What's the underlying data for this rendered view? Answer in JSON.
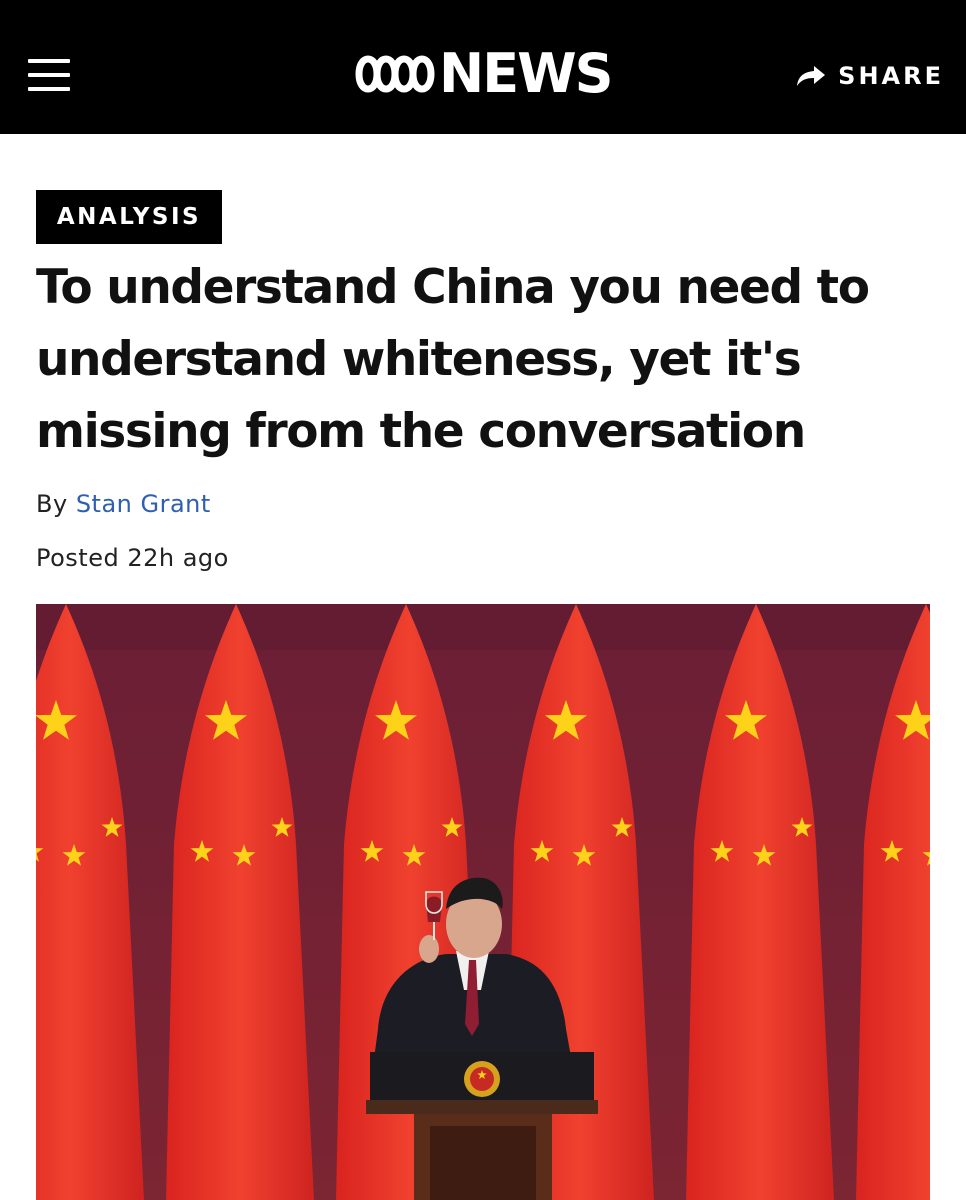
{
  "header": {
    "menu_icon": "hamburger-menu-icon",
    "logo_icon": "abc-lissajous-logo-icon",
    "logo_text": "NEWS",
    "share_icon": "share-arrow-icon",
    "share_label": "SHARE",
    "background_color": "#000000"
  },
  "article": {
    "category": "ANALYSIS",
    "headline": "To understand China you need to understand whiteness, yet it's missing from the conversation",
    "byline_prefix": "By",
    "author": "Stan Grant",
    "posted": "Posted 22h ago",
    "author_link_color": "#2e5fb0"
  },
  "hero_image": {
    "subject": "hero-photo",
    "colors": {
      "flag_red": "#e8332b",
      "star_yellow": "#ffd21a",
      "background_maroon": "#6e1f33"
    }
  }
}
